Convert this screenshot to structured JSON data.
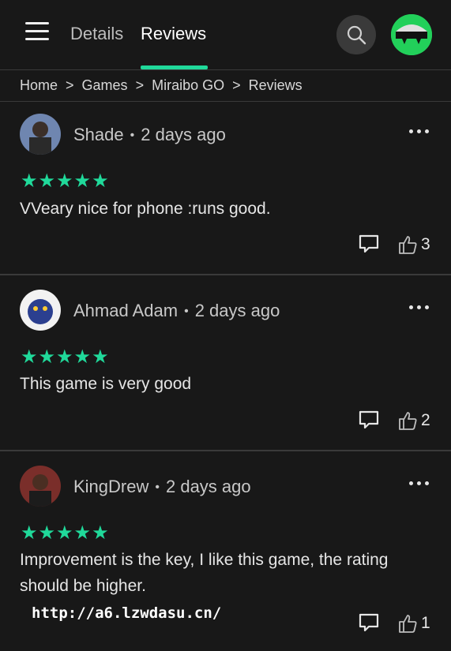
{
  "nav": {
    "menu_icon": "hamburger-menu-icon",
    "tabs": [
      {
        "label": "Details",
        "active": false
      },
      {
        "label": "Reviews",
        "active": true
      }
    ],
    "search_icon": "search-icon",
    "accent_color": "#20d99a"
  },
  "breadcrumb": [
    "Home",
    "Games",
    "Miraibo GO",
    "Reviews"
  ],
  "breadcrumb_separator": ">",
  "reviews": [
    {
      "author": "Shade",
      "time": "2 days ago",
      "rating": 5,
      "stars": "★★★★★",
      "text": "VVeary nice for phone :runs good.",
      "likes": "3"
    },
    {
      "author": "Ahmad Adam",
      "time": "2 days ago",
      "rating": 5,
      "stars": "★★★★★",
      "text": "This game is very good",
      "likes": "2"
    },
    {
      "author": "KingDrew",
      "time": "2 days ago",
      "rating": 5,
      "stars": "★★★★★",
      "text": "Improvement is the key, I like this game, the rating should be higher.",
      "likes": "1"
    }
  ],
  "watermark": "http://a6.lzwdasu.cn/"
}
